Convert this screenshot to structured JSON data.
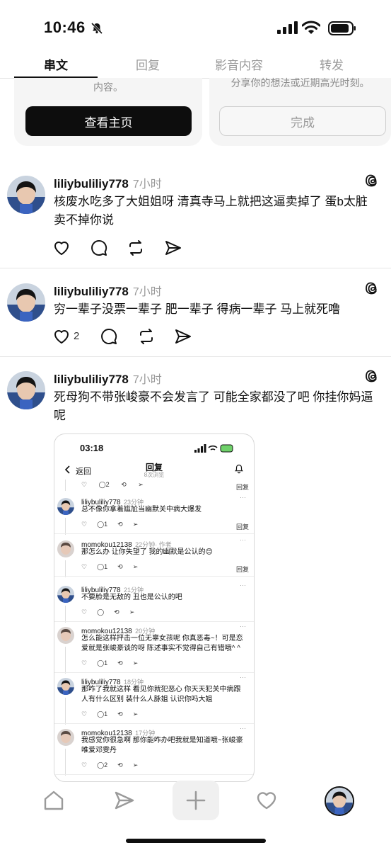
{
  "status_bar": {
    "time": "10:46"
  },
  "tabs": [
    {
      "label": "串文",
      "active": true
    },
    {
      "label": "回复",
      "active": false
    },
    {
      "label": "影音内容",
      "active": false
    },
    {
      "label": "转发",
      "active": false
    }
  ],
  "cards": {
    "left": {
      "text": "内容。",
      "button": "查看主页"
    },
    "right": {
      "text": "分享你的想法或近期高光时刻。",
      "button": "完成"
    }
  },
  "posts": [
    {
      "user": "liliybuliliy778",
      "time": "7小时",
      "text": "核废水吃多了大姐姐呀 清真寺马上就把这逼卖掉了 蛋b太脏卖不掉你说",
      "likes": ""
    },
    {
      "user": "liliybuliliy778",
      "time": "7小时",
      "text": "穷一辈子没票一辈子 肥一辈子 得病一辈子 马上就死噜",
      "likes": "2"
    },
    {
      "user": "liliybuliliy778",
      "time": "7小时",
      "text": "死母狗不带张峻豪不会发言了 可能全家都没了吧 你挂你妈逼呢",
      "likes": ""
    }
  ],
  "screenshot": {
    "time": "03:18",
    "back": "返回",
    "title": "回复",
    "subtitle": "8次浏览",
    "reply_label": "回复",
    "top_actions": {
      "comments": "2"
    },
    "comments": [
      {
        "user": "liliybuliliy778",
        "time": "23分钟",
        "text": "总不像你拿着尴尬当幽默关中病大爆发",
        "likes": "",
        "replies": "1",
        "show_reply": true,
        "author": ""
      },
      {
        "user": "momokou12138",
        "time": "22分钟",
        "author": "· 作者",
        "text": "那怎么办 让你失望了 我的幽默是公认的😊",
        "likes": "",
        "replies": "1",
        "show_reply": true
      },
      {
        "user": "liliybuliliy778",
        "time": "21分钟",
        "text": "不要脸是无敌的 丑也是公认的吧",
        "likes": "",
        "replies": "",
        "show_reply": false,
        "author": ""
      },
      {
        "user": "momokou12138",
        "time": "20分钟",
        "text": "怎么能这样抨击一位无辜女孩呢 你真恶毒~！可是恋爱就是张峻豪谈的呀 陈述事实不觉得自己有错哦^ ^",
        "likes": "",
        "replies": "1",
        "show_reply": false,
        "author": ""
      },
      {
        "user": "liliybuliliy778",
        "time": "18分钟",
        "text": "那咋了我就这样 看见你就犯恶心 你天天犯关中病跟人有什么区别 装什么人脉姐 认识你吗大姐",
        "likes": "",
        "replies": "1",
        "show_reply": false,
        "author": ""
      },
      {
        "user": "momokou12138",
        "time": "17分钟",
        "text": "我感觉你很急啊 那你能咋办吧我就是知道哦~张峻豪唯爱邓雯丹",
        "likes": "",
        "replies": "2",
        "show_reply": false,
        "author": ""
      }
    ]
  },
  "colors": {
    "text": "#111111",
    "muted": "#9a9a9a",
    "button_dark": "#0d0d0d"
  }
}
